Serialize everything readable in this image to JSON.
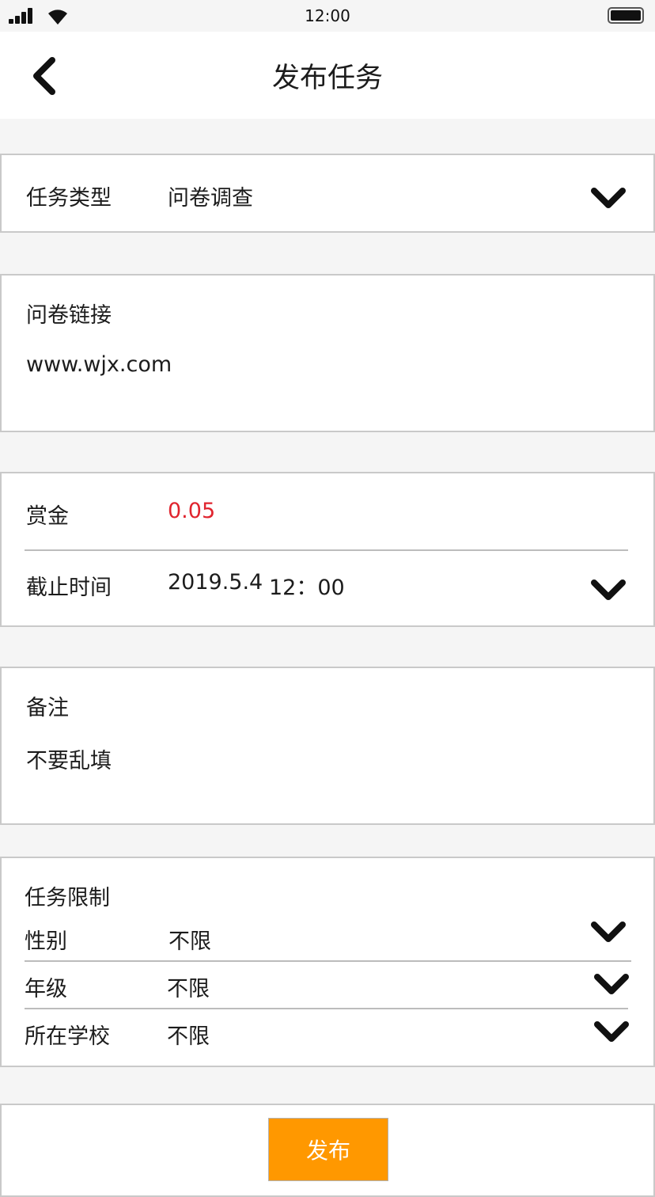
{
  "status_bar": {
    "time": "12:00"
  },
  "header": {
    "title": "发布任务"
  },
  "task_type": {
    "label": "任务类型",
    "value": "问卷调查"
  },
  "survey_link": {
    "label": "问卷链接",
    "value": "www.wjx.com"
  },
  "reward": {
    "label": "赏金",
    "value": "0.05",
    "value_color": "#e0242e"
  },
  "deadline": {
    "label": "截止时间",
    "date": "2019.5.4",
    "time": "12：00"
  },
  "note": {
    "label": "备注",
    "value": "不要乱填"
  },
  "restrictions": {
    "title": "任务限制",
    "rows": [
      {
        "label": "性别",
        "value": "不限"
      },
      {
        "label": "年级",
        "value": "不限"
      },
      {
        "label": "所在学校",
        "value": "不限"
      }
    ]
  },
  "publish": {
    "label": "发布",
    "color": "#ff9800"
  }
}
